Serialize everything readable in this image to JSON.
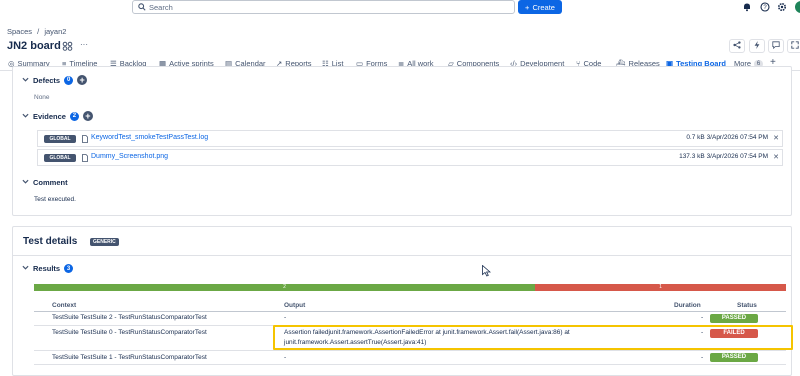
{
  "search": {
    "placeholder": "Search"
  },
  "create_label": "Create",
  "breadcrumb": {
    "spaces": "Spaces",
    "sep": "/",
    "project": "jayan2"
  },
  "board": {
    "title": "JN2 board",
    "more_glyph": "···"
  },
  "tabs": [
    {
      "label": "Summary"
    },
    {
      "label": "Timeline"
    },
    {
      "label": "Backlog"
    },
    {
      "label": "Active sprints"
    },
    {
      "label": "Calendar"
    },
    {
      "label": "Reports"
    },
    {
      "label": "List"
    },
    {
      "label": "Forms"
    },
    {
      "label": "All work"
    },
    {
      "label": "Components"
    },
    {
      "label": "Development"
    },
    {
      "label": "Code"
    },
    {
      "label": "Releases"
    },
    {
      "label": "Testing Board"
    },
    {
      "label": "More"
    }
  ],
  "more_count": "6",
  "defects": {
    "label": "Defects",
    "count": "0",
    "empty": "None"
  },
  "evidence": {
    "label": "Evidence",
    "count": "2",
    "files": [
      {
        "scope": "GLOBAL",
        "name": "KeywordTest_smokeTestPassTest.log",
        "size": "0.7 kB",
        "date": "3/Apr/2026 07:54 PM"
      },
      {
        "scope": "GLOBAL",
        "name": "Dummy_Screenshot.png",
        "size": "137.3 kB",
        "date": "3/Apr/2026 07:54 PM"
      }
    ]
  },
  "comment": {
    "label": "Comment",
    "text": "Test executed."
  },
  "test_details": {
    "title": "Test details",
    "tag": "GENERIC",
    "results_label": "Results",
    "results_count": "3",
    "bar": {
      "pass": 2,
      "fail": 1
    },
    "columns": {
      "context": "Context",
      "output": "Output",
      "duration": "Duration",
      "status": "Status"
    },
    "rows": [
      {
        "context": "TestSuite TestSuite 2 - TestRunStatusComparatorTest",
        "output": "-",
        "duration": "-",
        "status": "PASSED"
      },
      {
        "context": "TestSuite TestSuite 0 - TestRunStatusComparatorTest",
        "output_line1": "Assertion failedjunit.framework.AssertionFailedError at junit.framework.Assert.fail(Assert.java:86) at",
        "output_line2": "junit.framework.Assert.assertTrue(Assert.java:41)",
        "duration": "-",
        "status": "FAILED"
      },
      {
        "context": "TestSuite TestSuite 1 - TestRunStatusComparatorTest",
        "output": "-",
        "duration": "-",
        "status": "PASSED"
      }
    ]
  },
  "colors": {
    "accent": "#0c66e4",
    "passed": "#6ba845",
    "failed": "#d6584a",
    "highlight": "#f5c400"
  },
  "icons": [
    "search-icon",
    "plus-icon",
    "bell-icon",
    "help-icon",
    "gear-icon",
    "share-icon",
    "lightning-icon",
    "feedback-icon",
    "expand-icon",
    "chevron-down-icon",
    "file-icon",
    "cursor-icon"
  ]
}
